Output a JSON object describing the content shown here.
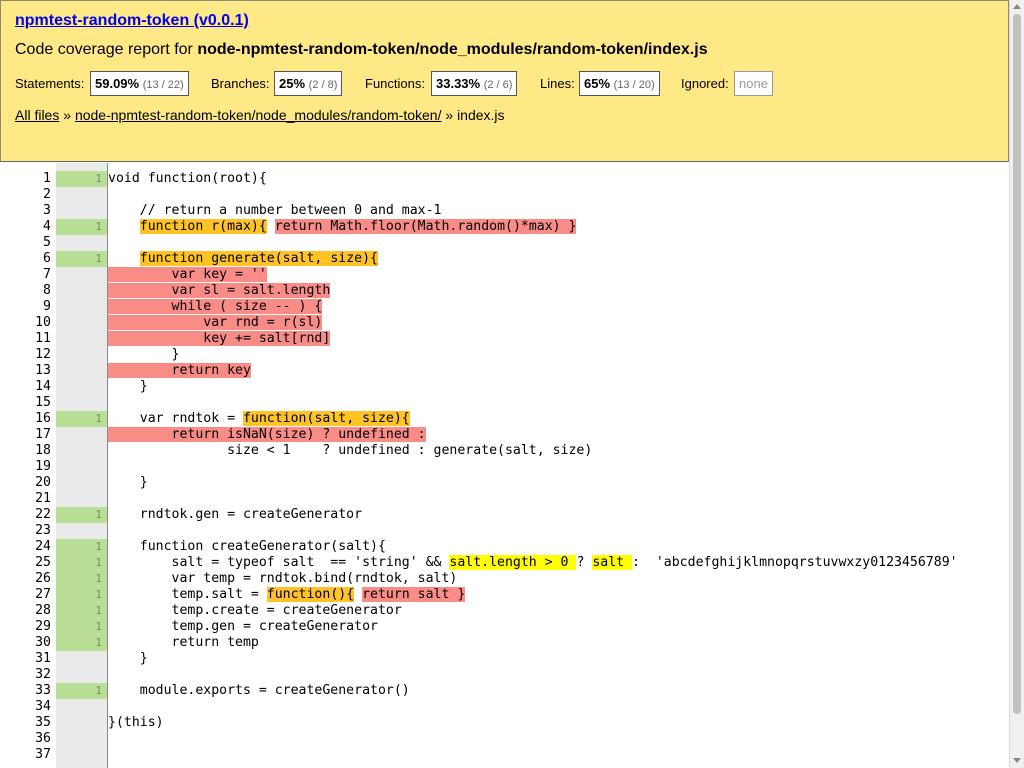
{
  "header": {
    "title": "npmtest-random-token (v0.0.1)",
    "report_prefix": "Code coverage report for ",
    "report_file": "node-npmtest-random-token/node_modules/random-token/index.js",
    "stats": [
      {
        "label": "Statements:",
        "pct": "59.09%",
        "frac": "(13 / 22)"
      },
      {
        "label": "Branches:",
        "pct": "25%",
        "frac": "(2 / 8)"
      },
      {
        "label": "Functions:",
        "pct": "33.33%",
        "frac": "(2 / 6)"
      },
      {
        "label": "Lines:",
        "pct": "65%",
        "frac": "(13 / 20)"
      },
      {
        "label": "Ignored:",
        "value": "none"
      }
    ],
    "breadcrumb": {
      "all_files": "All files",
      "sep1": " » ",
      "dir": "node-npmtest-random-token/node_modules/random-token/",
      "sep2": " » ",
      "file": "index.js"
    }
  },
  "code_lines": [
    {
      "n": "1",
      "count": "1",
      "cov": "hit",
      "segments": [
        {
          "t": "void function(root){"
        }
      ]
    },
    {
      "n": "2",
      "count": "",
      "cov": "none",
      "segments": [
        {
          "t": ""
        }
      ]
    },
    {
      "n": "3",
      "count": "",
      "cov": "none",
      "segments": [
        {
          "t": "    // return a number between 0 and max-1"
        }
      ]
    },
    {
      "n": "4",
      "count": "1",
      "cov": "hit",
      "segments": [
        {
          "t": "    "
        },
        {
          "t": "function r(max){",
          "hl": "y"
        },
        {
          "t": " "
        },
        {
          "t": "return Math.floor(Math.random()*max) }",
          "hl": "r"
        }
      ]
    },
    {
      "n": "5",
      "count": "",
      "cov": "none",
      "segments": [
        {
          "t": ""
        }
      ]
    },
    {
      "n": "6",
      "count": "1",
      "cov": "hit",
      "segments": [
        {
          "t": "    "
        },
        {
          "t": "function generate(salt, size){",
          "hl": "y"
        }
      ]
    },
    {
      "n": "7",
      "count": "",
      "cov": "miss",
      "segments": [
        {
          "t": "        var key = ''",
          "hl": "r"
        }
      ]
    },
    {
      "n": "8",
      "count": "",
      "cov": "miss",
      "segments": [
        {
          "t": "        var sl = salt.length",
          "hl": "r"
        }
      ]
    },
    {
      "n": "9",
      "count": "",
      "cov": "miss",
      "segments": [
        {
          "t": "        while ( size -- ) {",
          "hl": "r"
        }
      ]
    },
    {
      "n": "10",
      "count": "",
      "cov": "miss",
      "segments": [
        {
          "t": "            var rnd = r(sl)",
          "hl": "r"
        }
      ]
    },
    {
      "n": "11",
      "count": "",
      "cov": "miss",
      "segments": [
        {
          "t": "            key += salt[rnd]",
          "hl": "r"
        }
      ]
    },
    {
      "n": "12",
      "count": "",
      "cov": "none",
      "segments": [
        {
          "t": "        }"
        }
      ]
    },
    {
      "n": "13",
      "count": "",
      "cov": "miss",
      "segments": [
        {
          "t": "        return key",
          "hl": "r"
        }
      ]
    },
    {
      "n": "14",
      "count": "",
      "cov": "none",
      "segments": [
        {
          "t": "    }"
        }
      ]
    },
    {
      "n": "15",
      "count": "",
      "cov": "none",
      "segments": [
        {
          "t": ""
        }
      ]
    },
    {
      "n": "16",
      "count": "1",
      "cov": "hit",
      "segments": [
        {
          "t": "    var rndtok = "
        },
        {
          "t": "function(salt, size){",
          "hl": "y"
        }
      ]
    },
    {
      "n": "17",
      "count": "",
      "cov": "miss",
      "segments": [
        {
          "t": "        return isNaN(size) ? undefined :",
          "hl": "r"
        }
      ]
    },
    {
      "n": "18",
      "count": "",
      "cov": "none",
      "segments": [
        {
          "t": "               size < 1    ? undefined : generate(salt, size)"
        }
      ]
    },
    {
      "n": "19",
      "count": "",
      "cov": "none",
      "segments": [
        {
          "t": ""
        }
      ]
    },
    {
      "n": "20",
      "count": "",
      "cov": "none",
      "segments": [
        {
          "t": "    }"
        }
      ]
    },
    {
      "n": "21",
      "count": "",
      "cov": "none",
      "segments": [
        {
          "t": ""
        }
      ]
    },
    {
      "n": "22",
      "count": "1",
      "cov": "hit",
      "segments": [
        {
          "t": "    rndtok.gen = createGenerator"
        }
      ]
    },
    {
      "n": "23",
      "count": "",
      "cov": "none",
      "segments": [
        {
          "t": ""
        }
      ]
    },
    {
      "n": "24",
      "count": "1",
      "cov": "hit",
      "segments": [
        {
          "t": "    function createGenerator(salt){"
        }
      ]
    },
    {
      "n": "25",
      "count": "1",
      "cov": "hit",
      "segments": [
        {
          "t": "        salt = typeof salt  == 'string' && "
        },
        {
          "t": "salt.length > 0 ",
          "hl": "b"
        },
        {
          "t": "? "
        },
        {
          "t": "salt ",
          "hl": "b"
        },
        {
          "t": ":  'abcdefghijklmnopqrstuvwxzy0123456789'"
        }
      ]
    },
    {
      "n": "26",
      "count": "1",
      "cov": "hit",
      "segments": [
        {
          "t": "        var temp = rndtok.bind(rndtok, salt)"
        }
      ]
    },
    {
      "n": "27",
      "count": "1",
      "cov": "hit",
      "segments": [
        {
          "t": "        temp.salt = "
        },
        {
          "t": "function(){",
          "hl": "y"
        },
        {
          "t": " "
        },
        {
          "t": "return salt }",
          "hl": "r"
        }
      ]
    },
    {
      "n": "28",
      "count": "1",
      "cov": "hit",
      "segments": [
        {
          "t": "        temp.create = createGenerator"
        }
      ]
    },
    {
      "n": "29",
      "count": "1",
      "cov": "hit",
      "segments": [
        {
          "t": "        temp.gen = createGenerator"
        }
      ]
    },
    {
      "n": "30",
      "count": "1",
      "cov": "hit",
      "segments": [
        {
          "t": "        return temp"
        }
      ]
    },
    {
      "n": "31",
      "count": "",
      "cov": "none",
      "segments": [
        {
          "t": "    }"
        }
      ]
    },
    {
      "n": "32",
      "count": "",
      "cov": "none",
      "segments": [
        {
          "t": ""
        }
      ]
    },
    {
      "n": "33",
      "count": "1",
      "cov": "hit",
      "segments": [
        {
          "t": "    module.exports = createGenerator()"
        }
      ]
    },
    {
      "n": "34",
      "count": "",
      "cov": "none",
      "segments": [
        {
          "t": ""
        }
      ]
    },
    {
      "n": "35",
      "count": "",
      "cov": "none",
      "segments": [
        {
          "t": "}(this)"
        }
      ]
    },
    {
      "n": "36",
      "count": "",
      "cov": "none",
      "segments": [
        {
          "t": ""
        }
      ]
    },
    {
      "n": "37",
      "count": "",
      "cov": "none",
      "segments": [
        {
          "t": ""
        }
      ]
    }
  ],
  "colors": {
    "header_bg": "#ffe987",
    "hit": "#b9de95",
    "miss": "#fa8c87",
    "fn_not_covered": "#ffc326",
    "branch_not_covered": "#ffff00"
  }
}
